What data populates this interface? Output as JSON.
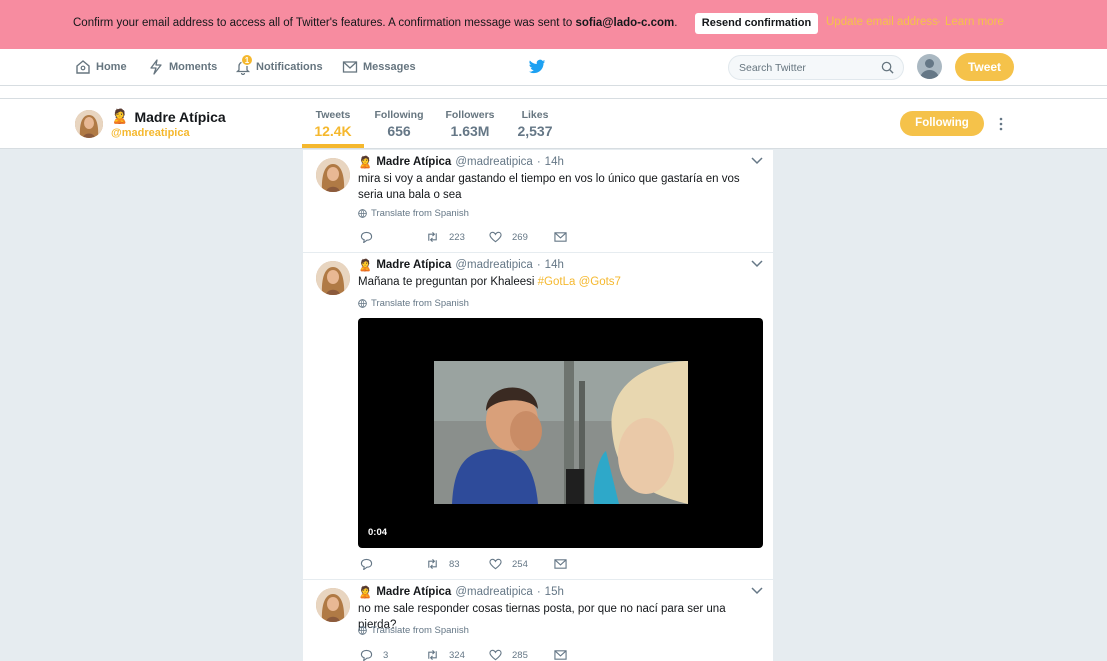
{
  "banner": {
    "message": "Confirm your email address to access all of Twitter's features. A confirmation message was sent to ",
    "email": "sofia@lado-c.com",
    "message_end": ".",
    "resend_label": "Resend confirmation",
    "update_link": "Update email address",
    "separator": "·",
    "learn_link": "Learn more"
  },
  "nav": {
    "home": "Home",
    "moments": "Moments",
    "notifications": "Notifications",
    "notif_count": "1",
    "messages": "Messages",
    "search_placeholder": "Search Twitter",
    "tweet_label": "Tweet"
  },
  "profile": {
    "emoji": "🙎",
    "name": "Madre Atípica",
    "handle": "@madreatipica",
    "stats": [
      {
        "label": "Tweets",
        "value": "12.4K"
      },
      {
        "label": "Following",
        "value": "656"
      },
      {
        "label": "Followers",
        "value": "1.63M"
      },
      {
        "label": "Likes",
        "value": "2,537"
      }
    ],
    "following_label": "Following"
  },
  "tweets": [
    {
      "emoji": "🙎",
      "name": "Madre Atípica",
      "handle": "@madreatipica",
      "dot": "·",
      "time": "14h",
      "text": "mira si voy a andar gastando el tiempo en vos lo único que gastaría en vos seria una bala o sea",
      "translate": "Translate from Spanish",
      "retweets": "223",
      "likes": "269",
      "replies": ""
    },
    {
      "emoji": "🙎",
      "name": "Madre Atípica",
      "handle": "@madreatipica",
      "dot": "·",
      "time": "14h",
      "text": "Mañana te preguntan por Khaleesi ",
      "tag1": "#GotLa",
      "tag2": "@Gots7",
      "translate": "Translate from Spanish",
      "media_time": "0:04",
      "retweets": "83",
      "likes": "254",
      "replies": ""
    },
    {
      "emoji": "🙎",
      "name": "Madre Atípica",
      "handle": "@madreatipica",
      "dot": "·",
      "time": "15h",
      "text": "no me sale responder cosas tiernas posta, por que no nací para ser una pierda?",
      "translate": "Translate from Spanish",
      "replies": "3",
      "retweets": "324",
      "likes": "285"
    }
  ],
  "colors": {
    "banner_bg": "#f78ca0",
    "accent": "#f5b82e",
    "accent_button": "#f5c24a",
    "twitter_blue": "#1da1f2",
    "page_bg": "#e6ecf0"
  }
}
